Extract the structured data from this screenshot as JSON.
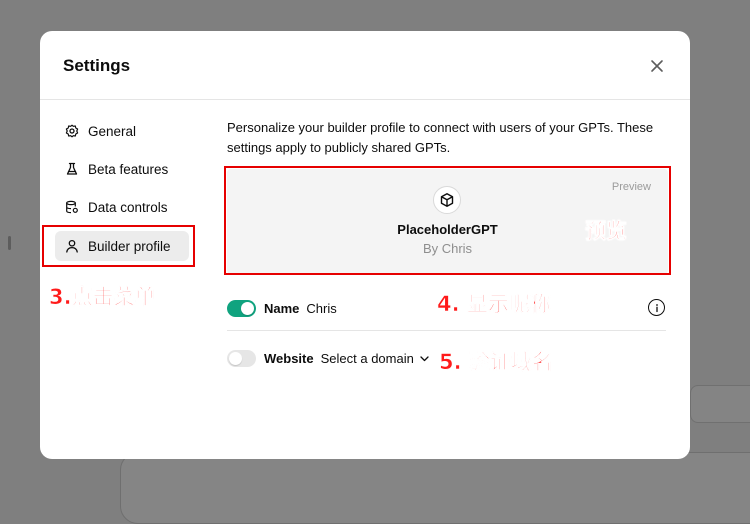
{
  "modal": {
    "title": "Settings",
    "close_icon": "close-icon"
  },
  "sidebar": {
    "items": [
      {
        "label": "General",
        "icon": "gear-icon"
      },
      {
        "label": "Beta features",
        "icon": "flask-icon"
      },
      {
        "label": "Data controls",
        "icon": "database-icon"
      },
      {
        "label": "Builder profile",
        "icon": "user-icon",
        "active": true
      }
    ]
  },
  "main": {
    "description": "Personalize your builder profile to connect with users of your GPTs. These settings apply to publicly shared GPTs.",
    "preview": {
      "label": "Preview",
      "gpt_name": "PlaceholderGPT",
      "author": "By Chris",
      "logo_icon": "cube-icon"
    },
    "name_row": {
      "label": "Name",
      "value": "Chris",
      "enabled": true,
      "info_icon": "info-icon"
    },
    "website_row": {
      "label": "Website",
      "select_value": "Select a domain",
      "enabled": false,
      "chevron_icon": "chevron-down-icon"
    }
  },
  "annotations": {
    "step3": "3.点击菜单",
    "step4": "4. 显示昵称",
    "step5": "5. 验证域名",
    "preview_note": "预览"
  },
  "colors": {
    "accent_green": "#10a37f",
    "annotation_red": "#e60000",
    "overlay": "#7f7f7f"
  }
}
